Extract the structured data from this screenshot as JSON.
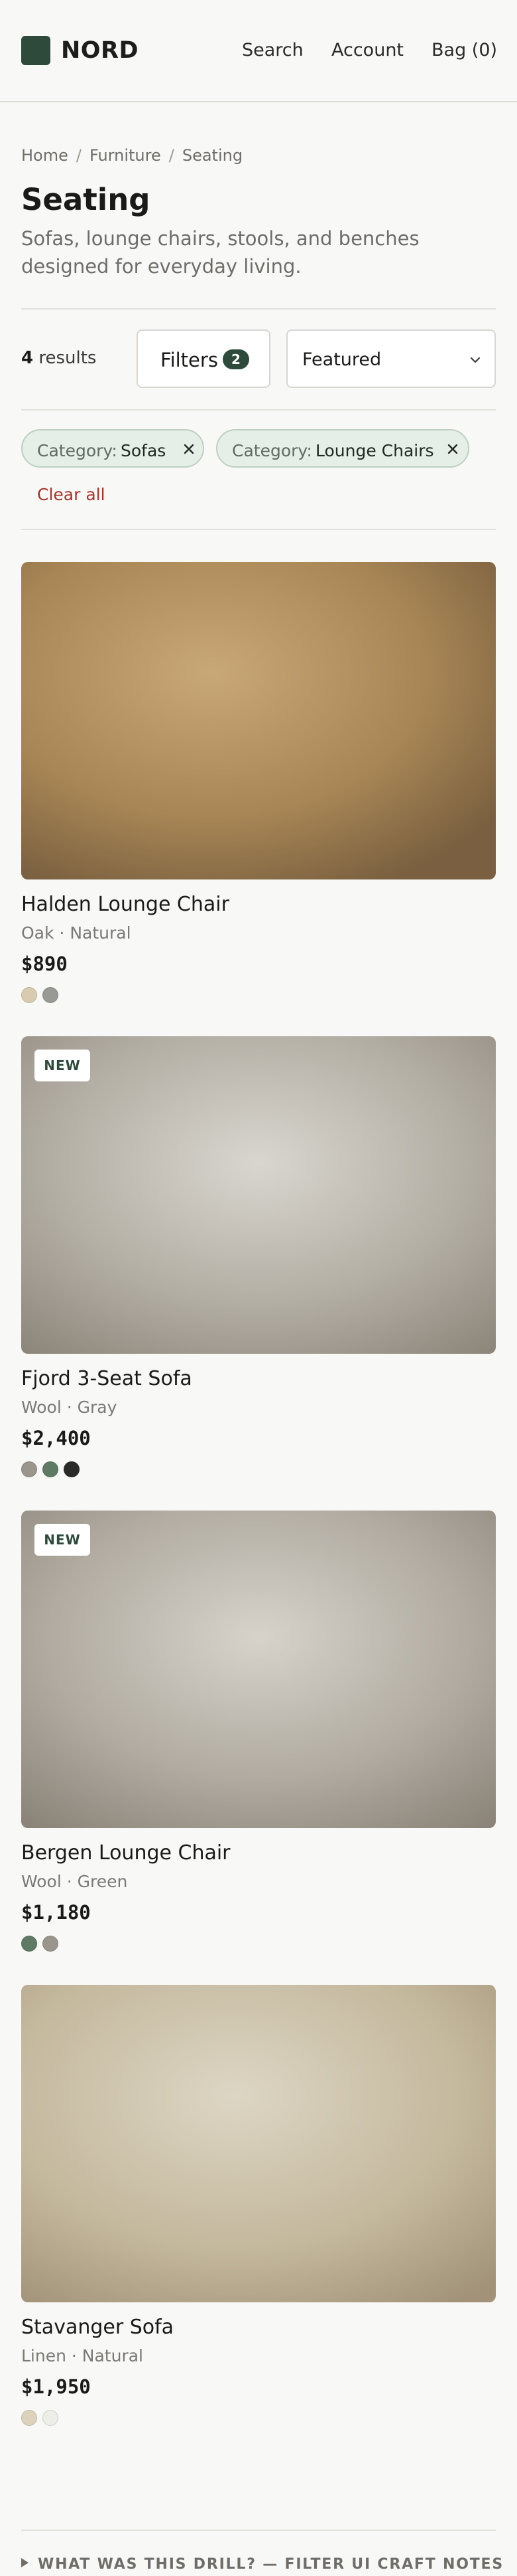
{
  "header": {
    "brand": "NORD",
    "nav": {
      "search": "Search",
      "account": "Account",
      "bag": "Bag (0)"
    }
  },
  "breadcrumb": [
    "Home",
    "Furniture",
    "Seating"
  ],
  "page": {
    "title": "Seating",
    "description": "Sofas, lounge chairs, stools, and benches designed for everyday living."
  },
  "toolbar": {
    "result_count": "4",
    "result_label": "results",
    "filters_label": "Filters",
    "filters_count": "2",
    "sort_value": "Featured"
  },
  "active_filters": [
    {
      "key": "Category:",
      "value": "Sofas"
    },
    {
      "key": "Category:",
      "value": "Lounge Chairs"
    }
  ],
  "clear_all": "Clear all",
  "products": [
    {
      "name": "Halden Lounge Chair",
      "meta": "Oak · Natural",
      "price": "$890",
      "badge": "",
      "swatches": [
        "#d8cbb0",
        "#9a9a94"
      ]
    },
    {
      "name": "Fjord 3-Seat Sofa",
      "meta": "Wool · Gray",
      "price": "$2,400",
      "badge": "NEW",
      "swatches": [
        "#9a968d",
        "#5e7a64",
        "#2a2a28"
      ]
    },
    {
      "name": "Bergen Lounge Chair",
      "meta": "Wool · Green",
      "price": "$1,180",
      "badge": "NEW",
      "swatches": [
        "#5e7a64",
        "#9a968d"
      ]
    },
    {
      "name": "Stavanger Sofa",
      "meta": "Linen · Natural",
      "price": "$1,950",
      "badge": "",
      "swatches": [
        "#ddd3bd",
        "#eceee8"
      ]
    }
  ],
  "colors": {
    "brand": "#2e4a3b",
    "accent_red": "#a8332b",
    "chip_bg": "#e6eee8"
  },
  "footer": {
    "note": "WHAT WAS THIS DRILL? — FILTER UI CRAFT NOTES"
  }
}
